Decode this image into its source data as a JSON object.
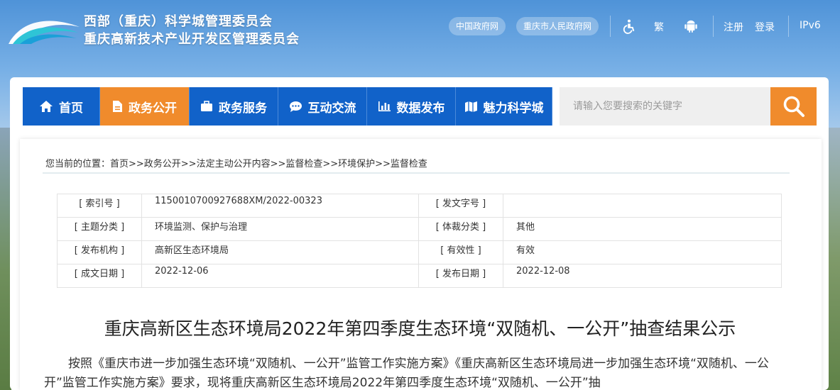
{
  "header": {
    "title_line1": "西部（重庆）科学城管理委员会",
    "title_line2": "重庆高新技术产业开发区管理委员会",
    "links": [
      "中国政府网",
      "重庆市人民政府网"
    ],
    "icons": [
      "accessibility-icon",
      "android-icon"
    ],
    "traditional_label": "繁",
    "register_label": "注册",
    "login_label": "登录",
    "ipv6_label": "IPv6"
  },
  "nav": {
    "items": [
      {
        "label": "首页",
        "icon": "home-icon"
      },
      {
        "label": "政务公开",
        "icon": "document-icon",
        "active": true
      },
      {
        "label": "政务服务",
        "icon": "briefcase-icon"
      },
      {
        "label": "互动交流",
        "icon": "chat-icon"
      },
      {
        "label": "数据发布",
        "icon": "bar-chart-icon"
      },
      {
        "label": "魅力科学城",
        "icon": "map-icon"
      }
    ],
    "search_placeholder": "请输入您要搜索的关键字"
  },
  "breadcrumb": "您当前的位置：首页>>政务公开>>法定主动公开内容>>监督检查>>环境保护>>监督检查",
  "meta": {
    "rows": [
      {
        "k1": "[ 索引号 ]",
        "v1": "1150010700927688XM/2022-00323",
        "k2": "[ 发文字号 ]",
        "v2": ""
      },
      {
        "k1": "[ 主题分类 ]",
        "v1": "环境监测、保护与治理",
        "k2": "[ 体裁分类 ]",
        "v2": "其他"
      },
      {
        "k1": "[ 发布机构 ]",
        "v1": "高新区生态环境局",
        "k2": "[ 有效性 ]",
        "v2": "有效"
      },
      {
        "k1": "[ 成文日期 ]",
        "v1": "2022-12-06",
        "k2": "[ 发布日期 ]",
        "v2": "2022-12-08"
      }
    ]
  },
  "document": {
    "title": "重庆高新区生态环境局2022年第四季度生态环境“双随机、一公开”抽查结果公示",
    "paragraph": "按照《重庆市进一步加强生态环境“双随机、一公开”监管工作实施方案》《重庆高新区生态环境局进一步加强生态环境“双随机、一公开”监管工作实施方案》要求，现将重庆高新区生态环境局2022年第四季度生态环境“双随机、一公开”抽"
  },
  "colors": {
    "nav_blue": "#1162c9",
    "accent_orange": "#f08b2c"
  }
}
